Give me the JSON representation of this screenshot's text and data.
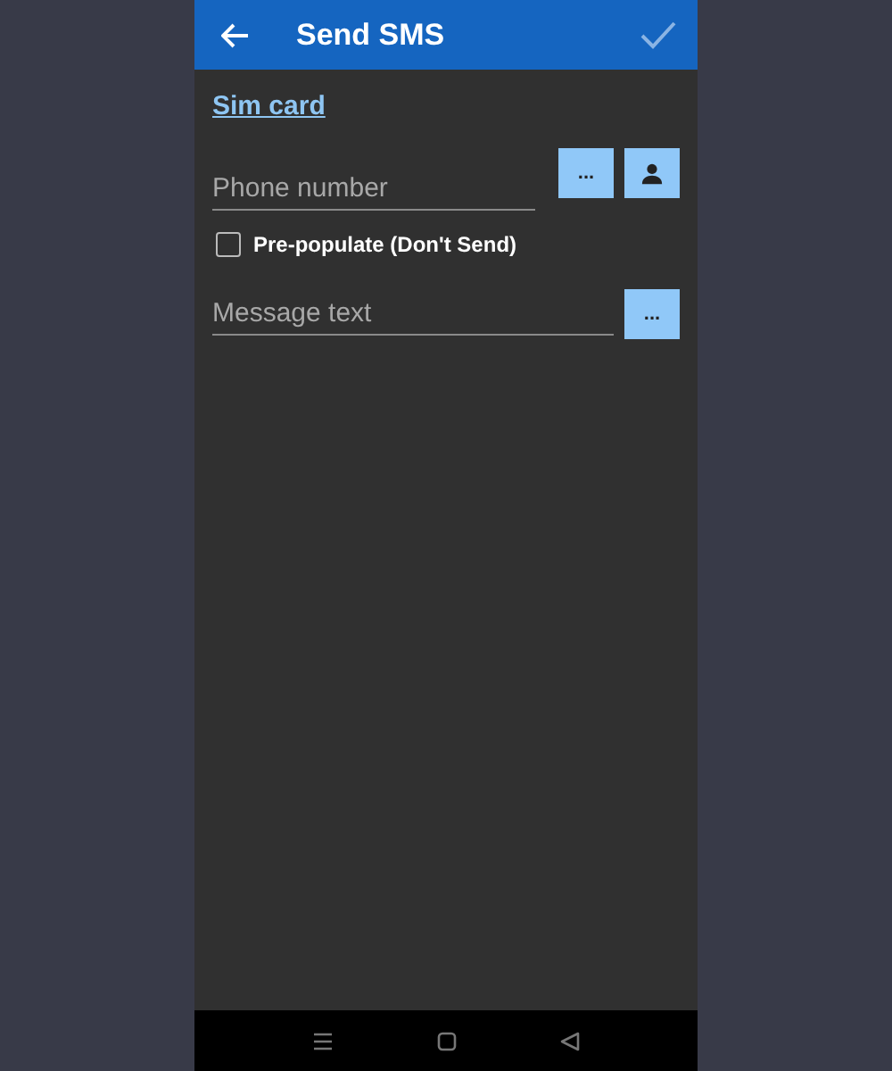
{
  "header": {
    "title": "Send SMS",
    "confirm_enabled": false
  },
  "sim_card": {
    "label": "Sim card"
  },
  "phone": {
    "placeholder": "Phone number",
    "buttons": [
      {
        "kind": "text",
        "label": "..."
      },
      {
        "kind": "contact"
      }
    ]
  },
  "pre_populate": {
    "label": "Pre-populate (Don't Send)",
    "checked": false
  },
  "message": {
    "placeholder": "Message text",
    "buttons": [
      {
        "kind": "text",
        "label": "..."
      }
    ]
  }
}
